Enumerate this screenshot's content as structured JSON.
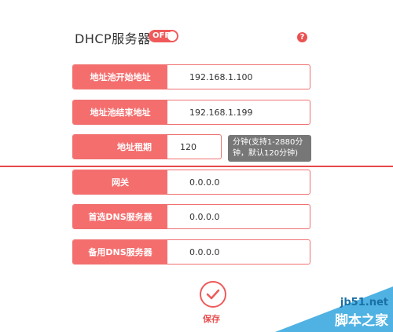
{
  "header": {
    "title": "DHCP服务器",
    "toggle_label": "OFF",
    "help_glyph": "?"
  },
  "fields": [
    {
      "label": "地址池开始地址",
      "value": "192.168.1.100"
    },
    {
      "label": "地址池结束地址",
      "value": "192.168.1.199"
    },
    {
      "label": "地址租期",
      "value": "120"
    },
    {
      "label": "网关",
      "value": "0.0.0.0"
    },
    {
      "label": "首选DNS服务器",
      "value": "0.0.0.0"
    },
    {
      "label": "备用DNS服务器",
      "value": "0.0.0.0"
    }
  ],
  "lease_tooltip": {
    "line1": "分钟(支持1-2880分",
    "line2": "钟，默认120分钟)"
  },
  "save_label": "保存",
  "watermark": {
    "url": "jb51.net",
    "name": "脚本之家"
  },
  "icons": {
    "help": "question-circle-icon",
    "save": "checkmark-circle-icon"
  },
  "colors": {
    "accent": "#f46e6e",
    "tooltip_bg": "#777777",
    "watermark_blue": "#4fb2e3"
  }
}
